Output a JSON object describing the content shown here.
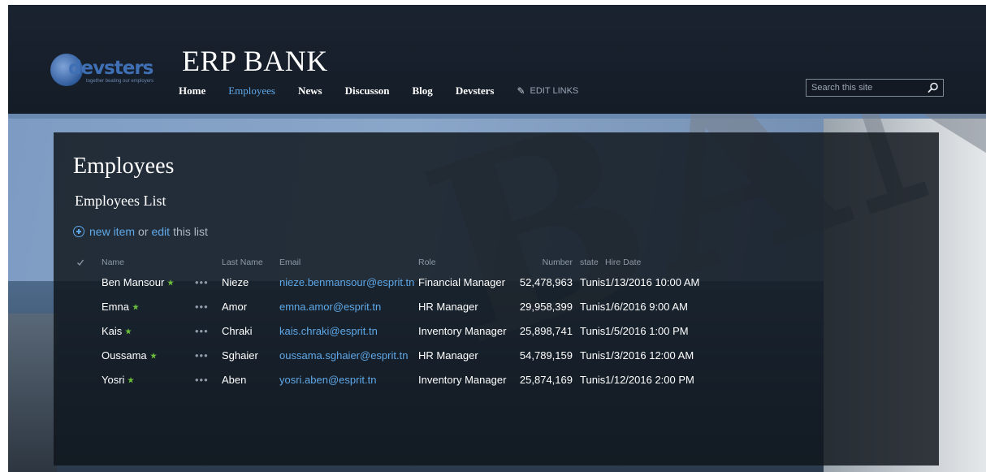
{
  "site": {
    "logo_text": "devsters",
    "logo_tag": "together beating our employers",
    "title": "ERP BANK"
  },
  "nav": {
    "items": [
      "Home",
      "Employees",
      "News",
      "Discusson",
      "Blog",
      "Devsters"
    ],
    "active": "Employees",
    "edit_links": "EDIT LINKS"
  },
  "search": {
    "placeholder": "Search this site"
  },
  "page": {
    "title": "Employees",
    "list_title": "Employees List",
    "new_item": "new item",
    "or": "or",
    "edit": "edit",
    "this_list": "this list"
  },
  "table": {
    "columns": {
      "name": "Name",
      "last_name": "Last Name",
      "email": "Email",
      "role": "Role",
      "number": "Number",
      "state": "state",
      "hire_date": "Hire Date"
    },
    "menu_glyph": "•••",
    "rows": [
      {
        "name": "Ben Mansour",
        "last_name": "Nieze",
        "email": "nieze.benmansour@esprit.tn",
        "role": "Financial Manager",
        "number": "52,478,963",
        "state": "Tunis",
        "hire_date": "1/13/2016 10:00 AM"
      },
      {
        "name": "Emna",
        "last_name": "Amor",
        "email": "emna.amor@esprit.tn",
        "role": "HR Manager",
        "number": "29,958,399",
        "state": "Tunis",
        "hire_date": "1/6/2016 9:00 AM"
      },
      {
        "name": "Kais",
        "last_name": "Chraki",
        "email": "kais.chraki@esprit.tn",
        "role": "Inventory Manager",
        "number": "25,898,741",
        "state": "Tunis",
        "hire_date": "1/5/2016 1:00 PM"
      },
      {
        "name": "Oussama",
        "last_name": "Sghaier",
        "email": "oussama.sghaier@esprit.tn",
        "role": "HR Manager",
        "number": "54,789,159",
        "state": "Tunis",
        "hire_date": "1/3/2016 12:00 AM"
      },
      {
        "name": "Yosri",
        "last_name": "Aben",
        "email": "yosri.aben@esprit.tn",
        "role": "Inventory Manager",
        "number": "25,874,169",
        "state": "Tunis",
        "hire_date": "1/12/2016 2:00 PM"
      }
    ]
  },
  "colors": {
    "accent": "#5fa8e8",
    "new_badge": "#6cbf3a",
    "header_bg": "#161e29"
  },
  "icons": {
    "new_badge": "new-badge-icon",
    "check": "check-icon",
    "pencil": "pencil-icon",
    "search": "search-icon",
    "add": "plus-circle-icon",
    "menu": "ellipsis-icon"
  }
}
